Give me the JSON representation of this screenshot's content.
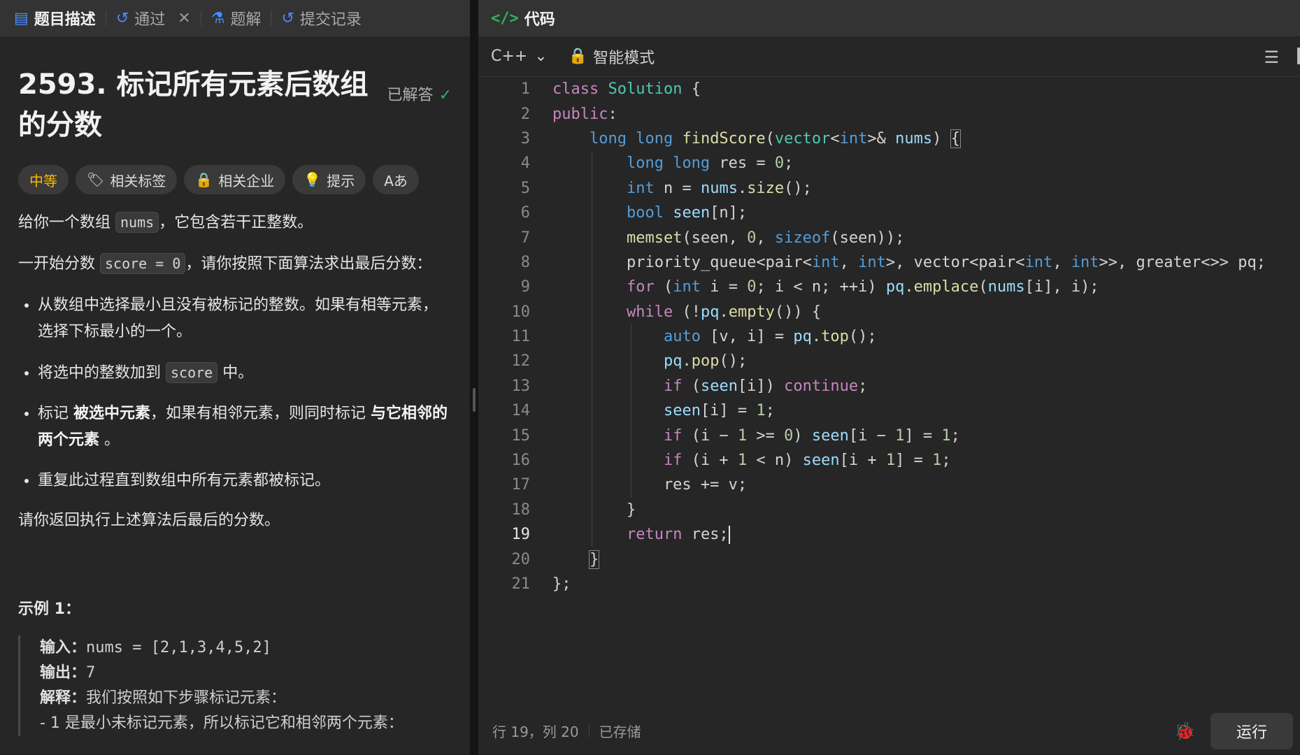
{
  "left_tabs": [
    {
      "label": "题目描述",
      "icon": "document-icon"
    },
    {
      "label": "通过",
      "icon": "history-icon"
    },
    {
      "label": "题解",
      "icon": "flask-icon"
    },
    {
      "label": "提交记录",
      "icon": "history-icon"
    }
  ],
  "problem": {
    "title": "2593. 标记所有元素后数组的分数",
    "status": "已解答",
    "chips": [
      "中等",
      "相关标签",
      "相关企业",
      "提示",
      "Aあ"
    ],
    "desc1_a": "给你一个数组",
    "desc1_code": "nums",
    "desc1_b": "，它包含若干正整数。",
    "desc2_a": "一开始分数",
    "desc2_code": "score = 0",
    "desc2_b": "，请你按照下面算法求出最后分数：",
    "rule1": "从数组中选择最小且没有被标记的整数。如果有相等元素，选择下标最小的一个。",
    "rule2_a": "将选中的整数加到",
    "rule2_code": "score",
    "rule2_b": "中。",
    "rule3_a": "标记",
    "rule3_b1": "被选中元素",
    "rule3_c": "，如果有相邻元素，则同时标记",
    "rule3_b2": "与它相邻的两个元素",
    "rule3_d": "。",
    "rule4": "重复此过程直到数组中所有元素都被标记。",
    "desc3": "请你返回执行上述算法后最后的分数。",
    "example_title": "示例 1：",
    "ex_input_label": "输入：",
    "ex_input": "nums = [2,1,3,4,5,2]",
    "ex_output_label": "输出：",
    "ex_output": "7",
    "ex_expl_label": "解释：",
    "ex_expl": "我们按照如下步骤标记元素：",
    "ex_step": "- 1 是最小未标记元素，所以标记它和相邻两个元素："
  },
  "editor": {
    "tab_label": "代码",
    "language": "C++",
    "mode": "智能模式",
    "status_pos": "行 19，列 20",
    "status_saved": "已存储",
    "run_label": "运行",
    "lines": [
      "1",
      "2",
      "3",
      "4",
      "5",
      "6",
      "7",
      "8",
      "9",
      "10",
      "11",
      "12",
      "13",
      "14",
      "15",
      "16",
      "17",
      "18",
      "19",
      "20",
      "21"
    ]
  }
}
